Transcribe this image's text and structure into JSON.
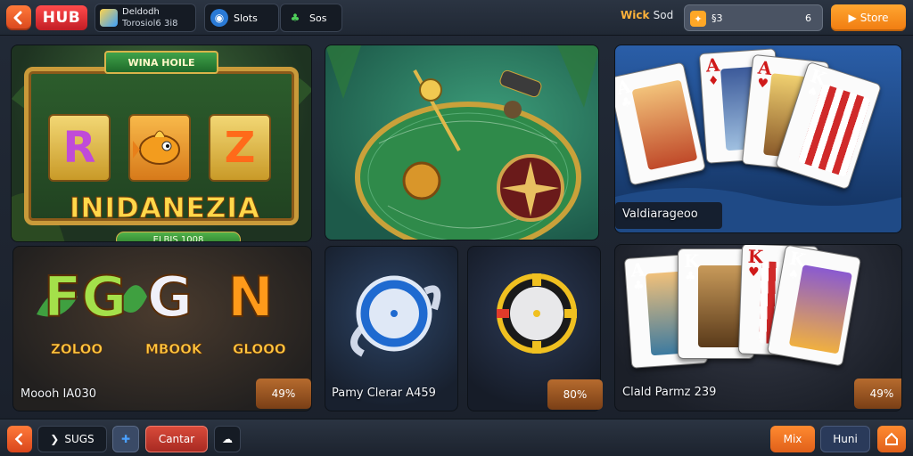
{
  "colors": {
    "accent_orange": "#f07b10",
    "hub_red": "#c21d25",
    "panel_dark": "#151b24"
  },
  "topbar": {
    "hub_label": "HUB",
    "user_line1": "Deldodh",
    "user_line2": "Torosiol6 3i8",
    "stat1": "Slots",
    "stat2": "Sos",
    "wins_label": "Wick",
    "wins_value": "Sod",
    "coin_a": "§3",
    "coin_b": "6",
    "store_label": "Store"
  },
  "tiles": {
    "slot1": {
      "banner": "WINA HOILE",
      "reels": [
        "R",
        "Z"
      ],
      "title": "INIDANEZIA",
      "sub": "ELBIS 1008"
    },
    "table": {},
    "cards1": {
      "label": "Valdiarageoo"
    },
    "slot2": {
      "letters": [
        "FG",
        "G",
        "N"
      ],
      "captions": [
        "ZOLOO",
        "MBOOK",
        "GLOOO"
      ],
      "label": "Moooh IA030",
      "pct": "49%"
    },
    "chip": {
      "label": "Pamy Clerar A459",
      "pct": "80%"
    },
    "cards2": {
      "label": "Clald Parmz 239",
      "pct": "49%"
    }
  },
  "bottombar": {
    "next_label": "SUGS",
    "center_label": "Cantar",
    "mix_label": "Mix",
    "hunt_label": "Huni"
  },
  "icons": [
    "back-arrow-icon",
    "user-avatar-icon",
    "slots-icon",
    "leaf-icon",
    "coin-icon",
    "store-arrow-icon",
    "puzzle-icon",
    "sheep-icon",
    "home-icon"
  ]
}
